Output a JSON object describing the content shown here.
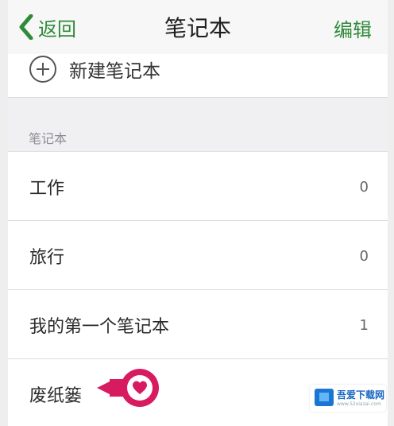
{
  "navbar": {
    "back_label": "返回",
    "title": "笔记本",
    "edit_label": "编辑"
  },
  "new_notebook_label": "新建笔记本",
  "section_header": "笔记本",
  "notebooks": [
    {
      "name": "工作",
      "count": "0"
    },
    {
      "name": "旅行",
      "count": "0"
    },
    {
      "name": "我的第一个笔记本",
      "count": "1"
    },
    {
      "name": "废纸篓",
      "count": ""
    }
  ],
  "watermark": {
    "text": "吾爱下载网",
    "subtext": "www.52xiazai.com"
  },
  "colors": {
    "accent": "#2f8a3a",
    "callout": "#d81b60"
  },
  "icons": [
    "chevron-left-icon",
    "plus-circle-icon",
    "heart-icon"
  ]
}
